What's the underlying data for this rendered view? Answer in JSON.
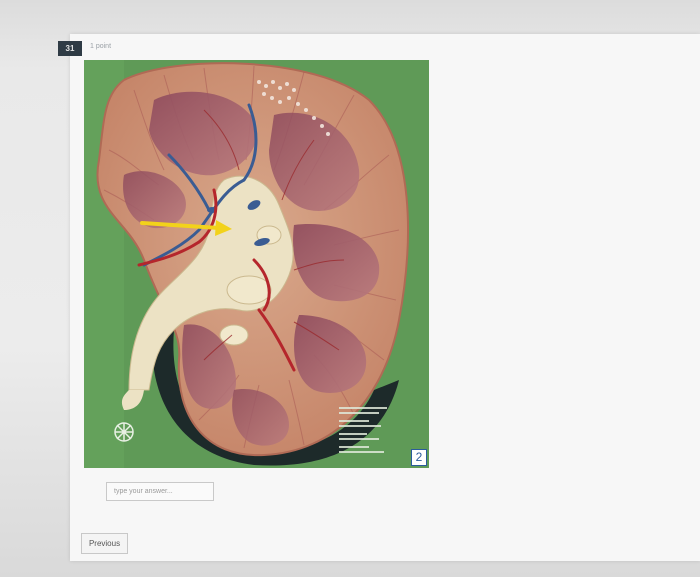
{
  "question": {
    "number": "31",
    "points": "1 point"
  },
  "figure": {
    "caption_number": "2",
    "arrow_color": "#f2d21b",
    "background_color": "#5f9a57"
  },
  "answer": {
    "placeholder": "type your answer..."
  },
  "navigation": {
    "previous_label": "Previous"
  }
}
